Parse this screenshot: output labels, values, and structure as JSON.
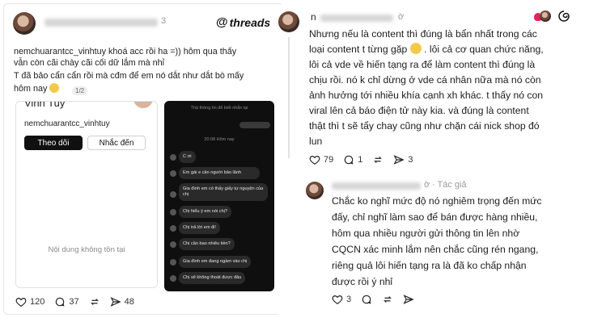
{
  "left_post": {
    "time": "3",
    "brand": "threads",
    "text_line1": "nemchuarantcc_vinhtuy khoá acc rồi ha =)) hôm qua thấy",
    "text_line2": "vẫn còn cãi chày cãi cối dữ lắm mà nhỉ",
    "text_line3": "T đã bảo cẩn cẩn rồi mà cđm để em nó dắt như dắt bò mấy",
    "text_line4": "hôm nay",
    "pager": "1/2",
    "profile_card": {
      "name_cut": "Vinh Tuy",
      "handle": "nemchuarantcc_vinhtuy",
      "follow_button": "Theo dõi",
      "mention_button": "Nhắc đến",
      "empty_state": "Nội dung không tồn tại"
    },
    "chat": {
      "system_notice": "Thả thông tin để biết nhắn lại",
      "time_label": "20:08 Hôm nay",
      "messages": [
        "C ơi",
        "Em gái e cần người bảo lãnh",
        "Gia đình em có thấy giấy tự nguyện của chị",
        "Chị hiểu ý em nói chị?",
        "Chị trả lời em đi!",
        "Chị cần bao nhiêu tiền?",
        "Gia đình em đang ngầm vào chị",
        "Chị sẽ không thoát được đâu"
      ]
    },
    "likes": "120",
    "replies": "37",
    "shares": "48"
  },
  "right_top_post": {
    "username_initial": "n",
    "time": "ờ",
    "lines": [
      "Nhưng nếu là content thì đúng là bẩn nhất trong các",
      "loại content t từng gặp",
      ". lôi cả cơ quan chức năng,",
      "lôi cả vde về hiến tạng ra để làm content thì đúng là",
      "chịu rồi. nó k chỉ dừng ở vde cá nhân nữa mà nó còn",
      "ảnh hưởng tới nhiều khía cạnh xh khác. t thấy nó con",
      "viral lên cả báo điện tử này kia. và đúng là content",
      "thật thì t sẽ tẩy chay cũng như chặn cái nick shop đó",
      "lun"
    ],
    "likes": "79",
    "replies": "1",
    "shares": "3"
  },
  "right_bottom_post": {
    "time": "ờ",
    "author_tag": "· Tác giả",
    "lines": [
      "Chắc ko nghĩ mức độ nó nghiêm trọng đến mức",
      "đấy, chỉ nghĩ làm sao để bán được hàng nhiều,",
      "hôm qua nhiều người gửi thông tin lên nhờ",
      "CQCN xác minh lắm nên chắc cũng rén ngang,",
      "riêng quả lôi hiến tạng ra là đã ko chấp nhận",
      "được rồi ý nhỉ"
    ],
    "likes": "3"
  },
  "colors": {
    "text": "#1d1d1d",
    "muted": "#9a9a9a",
    "dark_button": "#101010",
    "chat_bg": "#0f0f0f",
    "heart_red": "#e0245e"
  }
}
